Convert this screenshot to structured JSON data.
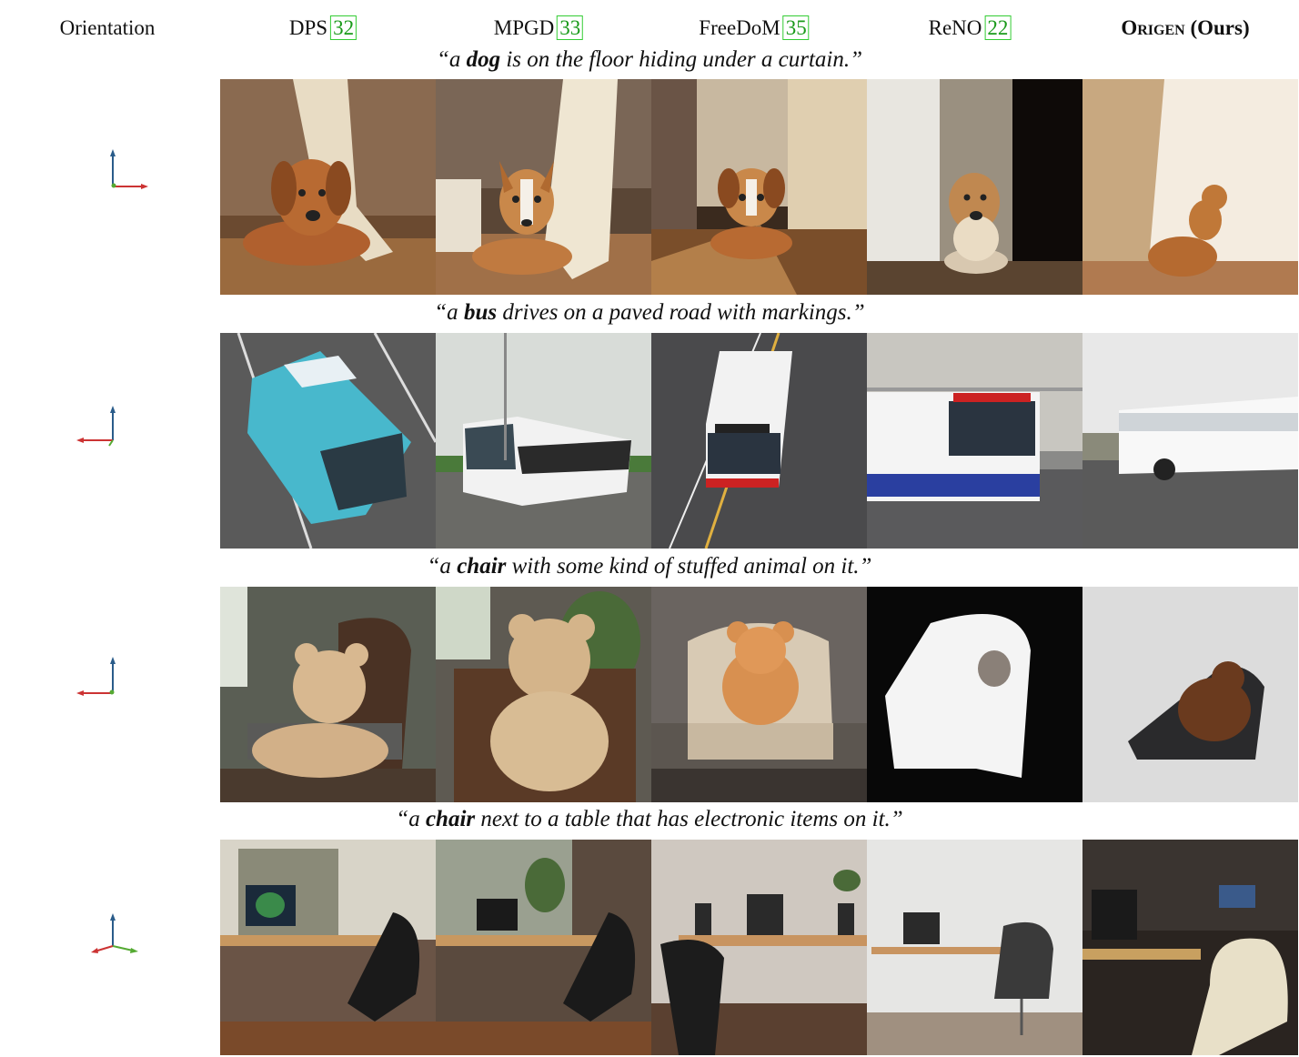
{
  "header": {
    "orientation": "Orientation",
    "methods": [
      {
        "name": "DPS",
        "ref": "32"
      },
      {
        "name": "MPGD",
        "ref": "33"
      },
      {
        "name": "FreeDoM",
        "ref": "35"
      },
      {
        "name": "ReNO",
        "ref": "22"
      }
    ],
    "ours_name": "Origen",
    "ours_suffix": " (Ours)"
  },
  "rows": [
    {
      "caption_pre": "“a ",
      "caption_bold": "dog",
      "caption_post": " is on the floor  hiding under a curtain.”"
    },
    {
      "caption_pre": "“a ",
      "caption_bold": "bus",
      "caption_post": " drives on a paved  road with markings.”"
    },
    {
      "caption_pre": "“a ",
      "caption_bold": "chair",
      "caption_post": " with some kind of stuffed animal on it.”"
    },
    {
      "caption_pre": "“a ",
      "caption_bold": "chair",
      "caption_post": " next to a table that has electronic items on it.”"
    }
  ],
  "colors": {
    "axis_up": "#2a5c8a",
    "axis_x": "#cc3333",
    "axis_z": "#55aa33"
  }
}
